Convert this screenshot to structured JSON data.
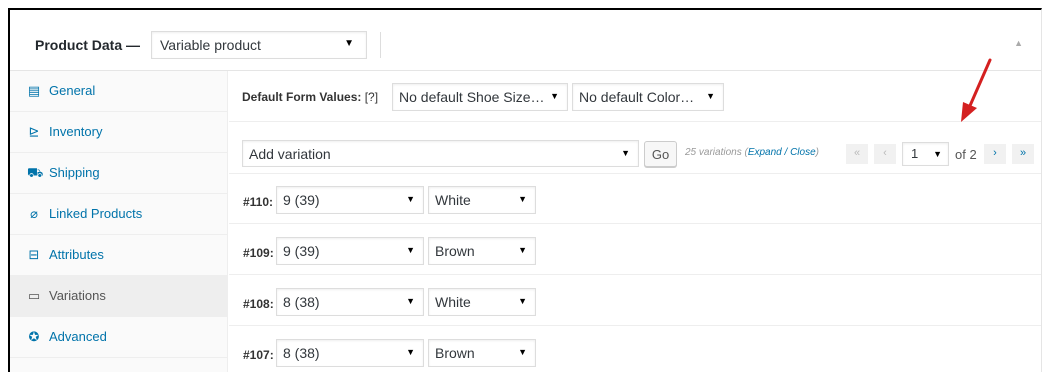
{
  "header": {
    "title": "Product Data —",
    "product_type": "Variable product"
  },
  "tabs": [
    {
      "label": "General",
      "icon": "general-icon"
    },
    {
      "label": "Inventory",
      "icon": "inventory-icon"
    },
    {
      "label": "Shipping",
      "icon": "shipping-icon"
    },
    {
      "label": "Linked Products",
      "icon": "link-icon"
    },
    {
      "label": "Attributes",
      "icon": "attributes-icon"
    },
    {
      "label": "Variations",
      "icon": "variations-icon",
      "active": true
    },
    {
      "label": "Advanced",
      "icon": "gear-icon"
    }
  ],
  "defaults": {
    "label": "Default Form Values:",
    "help": "[?]",
    "shoe_size": "No default Shoe Size…",
    "color": "No default Color…"
  },
  "toolbar": {
    "add_variation": "Add variation",
    "go": "Go",
    "count_text": "25 variations",
    "expand": "Expand",
    "slash": " / ",
    "close": "Close",
    "first": "«",
    "prev": "‹",
    "page": "1",
    "of": "of 2",
    "next": "›",
    "last": "»"
  },
  "variations": [
    {
      "id": "#110:",
      "size": "9 (39)",
      "color": "White"
    },
    {
      "id": "#109:",
      "size": "9 (39)",
      "color": "Brown"
    },
    {
      "id": "#108:",
      "size": "8 (38)",
      "color": "White"
    },
    {
      "id": "#107:",
      "size": "8 (38)",
      "color": "Brown"
    }
  ],
  "colors": {
    "link": "#0073aa",
    "annotation_arrow": "#d42020"
  }
}
